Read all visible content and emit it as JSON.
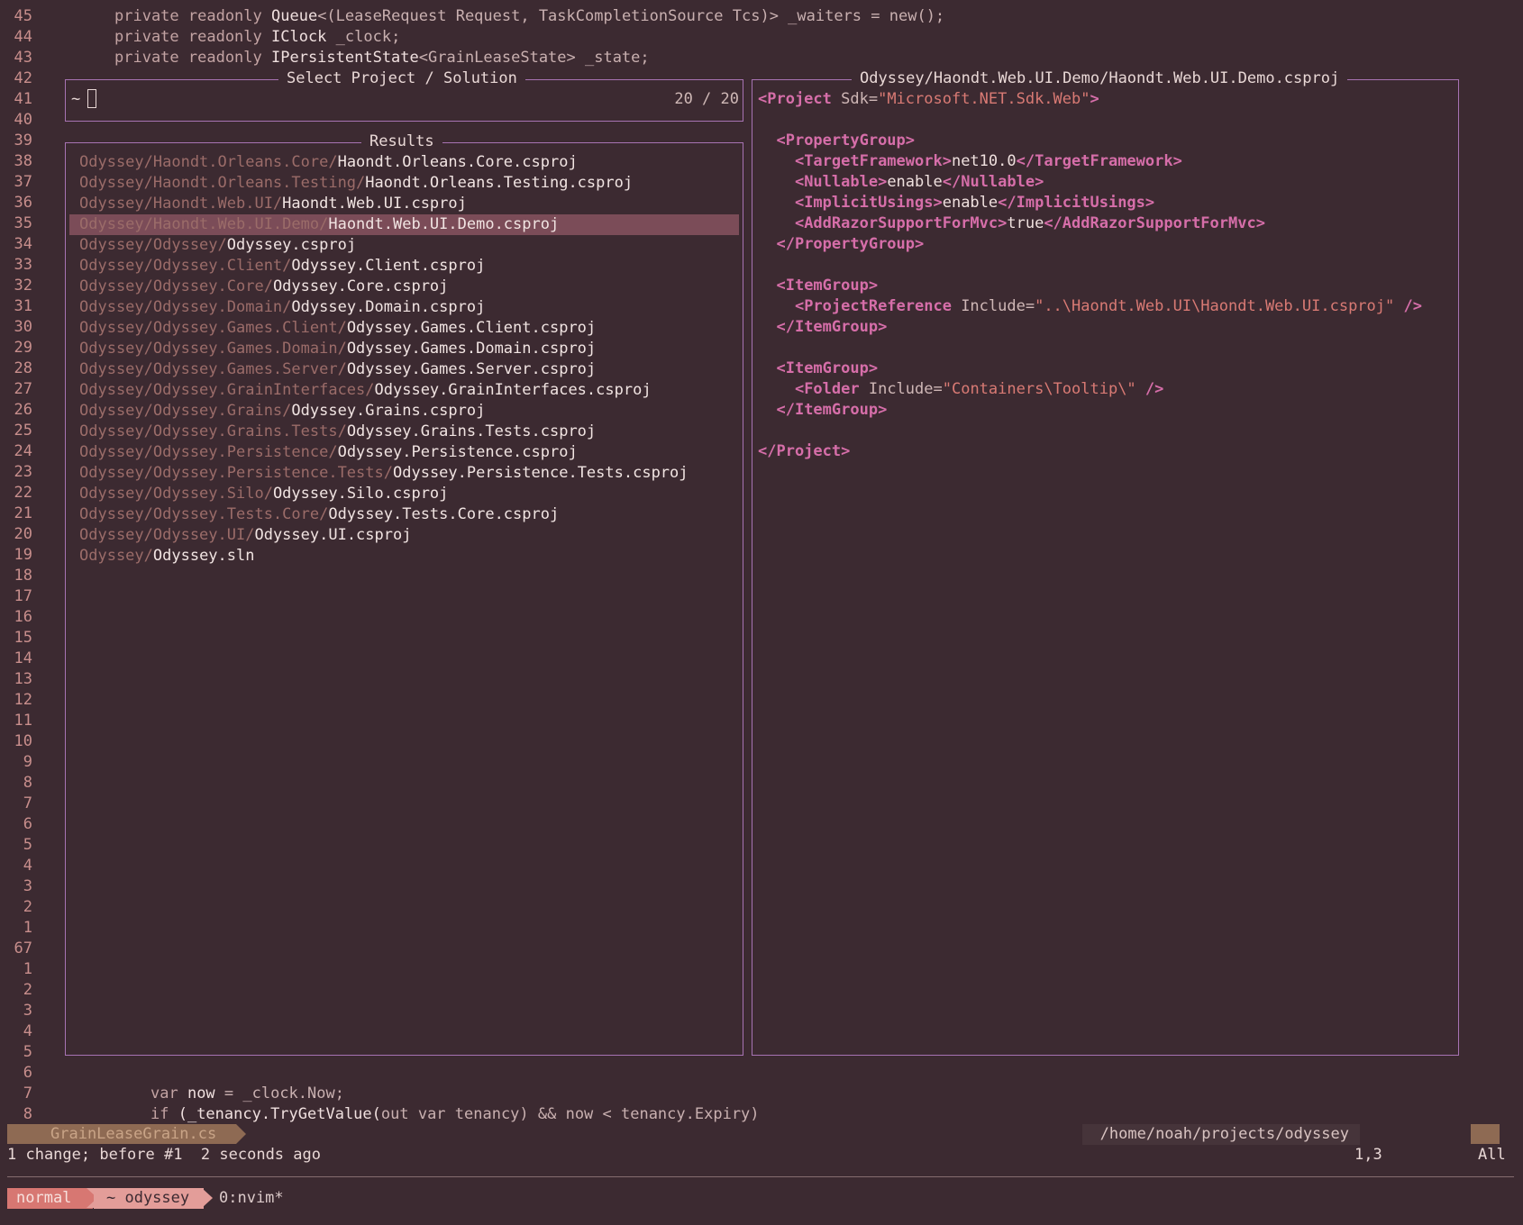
{
  "editor": {
    "top_line_numbers": [
      "45",
      "44",
      "43",
      "42",
      "41",
      "40",
      "39",
      "38",
      "37",
      "36",
      "35",
      "34",
      "33",
      "32",
      "31",
      "30",
      "29",
      "28",
      "27",
      "26",
      "25",
      "24",
      "23",
      "22",
      "21",
      "20",
      "19",
      "18",
      "17",
      "16",
      "15",
      "14",
      "13",
      "12",
      "11",
      "10",
      "9",
      "8",
      "7",
      "6",
      "5",
      "4",
      "3",
      "2",
      "1",
      "67",
      "1",
      "2",
      "3",
      "4",
      "5",
      "6",
      "7",
      "8"
    ],
    "code_top": [
      {
        "kw": "private readonly ",
        "ty": "Queue",
        "rest": "<(LeaseRequest Request, TaskCompletionSource Tcs)> _waiters = new();"
      },
      {
        "kw": "private readonly ",
        "ty": "IClock",
        "rest": " _clock;"
      },
      {
        "kw": "private readonly ",
        "ty": "IPersistentState",
        "rest": "<GrainLeaseState> _state;"
      }
    ],
    "code_bottom": [
      {
        "kw": "var ",
        "ty": "now",
        "rest": " = _clock.Now;"
      },
      {
        "kw": "if ",
        "ty": "(_tenancy.TryGetValue(",
        "rest": "out var tenancy) && now < tenancy.Expiry)"
      }
    ]
  },
  "picker": {
    "title": "Select Project / Solution",
    "prompt": "~",
    "counter": "20 / 20",
    "results_title": "Results",
    "results": [
      {
        "dir": "Odyssey/Haondt.Orleans.Core/",
        "file": "Haondt.Orleans.Core.csproj"
      },
      {
        "dir": "Odyssey/Haondt.Orleans.Testing/",
        "file": "Haondt.Orleans.Testing.csproj"
      },
      {
        "dir": "Odyssey/Haondt.Web.UI/",
        "file": "Haondt.Web.UI.csproj"
      },
      {
        "dir": "Odyssey/Haondt.Web.UI.Demo/",
        "file": "Haondt.Web.UI.Demo.csproj"
      },
      {
        "dir": "Odyssey/Odyssey/",
        "file": "Odyssey.csproj"
      },
      {
        "dir": "Odyssey/Odyssey.Client/",
        "file": "Odyssey.Client.csproj"
      },
      {
        "dir": "Odyssey/Odyssey.Core/",
        "file": "Odyssey.Core.csproj"
      },
      {
        "dir": "Odyssey/Odyssey.Domain/",
        "file": "Odyssey.Domain.csproj"
      },
      {
        "dir": "Odyssey/Odyssey.Games.Client/",
        "file": "Odyssey.Games.Client.csproj"
      },
      {
        "dir": "Odyssey/Odyssey.Games.Domain/",
        "file": "Odyssey.Games.Domain.csproj"
      },
      {
        "dir": "Odyssey/Odyssey.Games.Server/",
        "file": "Odyssey.Games.Server.csproj"
      },
      {
        "dir": "Odyssey/Odyssey.GrainInterfaces/",
        "file": "Odyssey.GrainInterfaces.csproj"
      },
      {
        "dir": "Odyssey/Odyssey.Grains/",
        "file": "Odyssey.Grains.csproj"
      },
      {
        "dir": "Odyssey/Odyssey.Grains.Tests/",
        "file": "Odyssey.Grains.Tests.csproj"
      },
      {
        "dir": "Odyssey/Odyssey.Persistence/",
        "file": "Odyssey.Persistence.csproj"
      },
      {
        "dir": "Odyssey/Odyssey.Persistence.Tests/",
        "file": "Odyssey.Persistence.Tests.csproj"
      },
      {
        "dir": "Odyssey/Odyssey.Silo/",
        "file": "Odyssey.Silo.csproj"
      },
      {
        "dir": "Odyssey/Odyssey.Tests.Core/",
        "file": "Odyssey.Tests.Core.csproj"
      },
      {
        "dir": "Odyssey/Odyssey.UI/",
        "file": "Odyssey.UI.csproj"
      },
      {
        "dir": "Odyssey/",
        "file": "Odyssey.sln"
      }
    ],
    "selected_index": 3
  },
  "preview": {
    "title": "Odyssey/Haondt.Web.UI.Demo/Haondt.Web.UI.Demo.csproj",
    "lines": [
      [
        [
          "tag",
          "<Project "
        ],
        [
          "attr",
          "Sdk="
        ],
        [
          "str",
          "\"Microsoft.NET.Sdk.Web\""
        ],
        [
          "tag",
          ">"
        ]
      ],
      [],
      [
        [
          "txt",
          "  "
        ],
        [
          "tag",
          "<PropertyGroup>"
        ]
      ],
      [
        [
          "txt",
          "    "
        ],
        [
          "tag",
          "<TargetFramework>"
        ],
        [
          "txt",
          "net10.0"
        ],
        [
          "tag",
          "</TargetFramework>"
        ]
      ],
      [
        [
          "txt",
          "    "
        ],
        [
          "tag",
          "<Nullable>"
        ],
        [
          "txt",
          "enable"
        ],
        [
          "tag",
          "</Nullable>"
        ]
      ],
      [
        [
          "txt",
          "    "
        ],
        [
          "tag",
          "<ImplicitUsings>"
        ],
        [
          "txt",
          "enable"
        ],
        [
          "tag",
          "</ImplicitUsings>"
        ]
      ],
      [
        [
          "txt",
          "    "
        ],
        [
          "tag",
          "<AddRazorSupportForMvc>"
        ],
        [
          "txt",
          "true"
        ],
        [
          "tag",
          "</AddRazorSupportForMvc>"
        ]
      ],
      [
        [
          "txt",
          "  "
        ],
        [
          "tag",
          "</PropertyGroup>"
        ]
      ],
      [],
      [
        [
          "txt",
          "  "
        ],
        [
          "tag",
          "<ItemGroup>"
        ]
      ],
      [
        [
          "txt",
          "    "
        ],
        [
          "tag",
          "<ProjectReference "
        ],
        [
          "attr",
          "Include="
        ],
        [
          "str",
          "\"..\\Haondt.Web.UI\\Haondt.Web.UI.csproj\""
        ],
        [
          "tag",
          " />"
        ]
      ],
      [
        [
          "txt",
          "  "
        ],
        [
          "tag",
          "</ItemGroup>"
        ]
      ],
      [],
      [
        [
          "txt",
          "  "
        ],
        [
          "tag",
          "<ItemGroup>"
        ]
      ],
      [
        [
          "txt",
          "    "
        ],
        [
          "tag",
          "<Folder "
        ],
        [
          "attr",
          "Include="
        ],
        [
          "str",
          "\"Containers\\Tooltip\\\""
        ],
        [
          "tag",
          " />"
        ]
      ],
      [
        [
          "txt",
          "  "
        ],
        [
          "tag",
          "</ItemGroup>"
        ]
      ],
      [],
      [
        [
          "tag",
          "</Project>"
        ]
      ]
    ]
  },
  "statusline": {
    "filename": "GrainLeaseGrain.cs",
    "path": "/home/noah/projects/odyssey",
    "message": "1 change; before #1  2 seconds ago",
    "position": "1,3",
    "scroll": "All"
  },
  "tmux": {
    "mode": "normal",
    "session": "~ odyssey",
    "window": "0:nvim*"
  }
}
